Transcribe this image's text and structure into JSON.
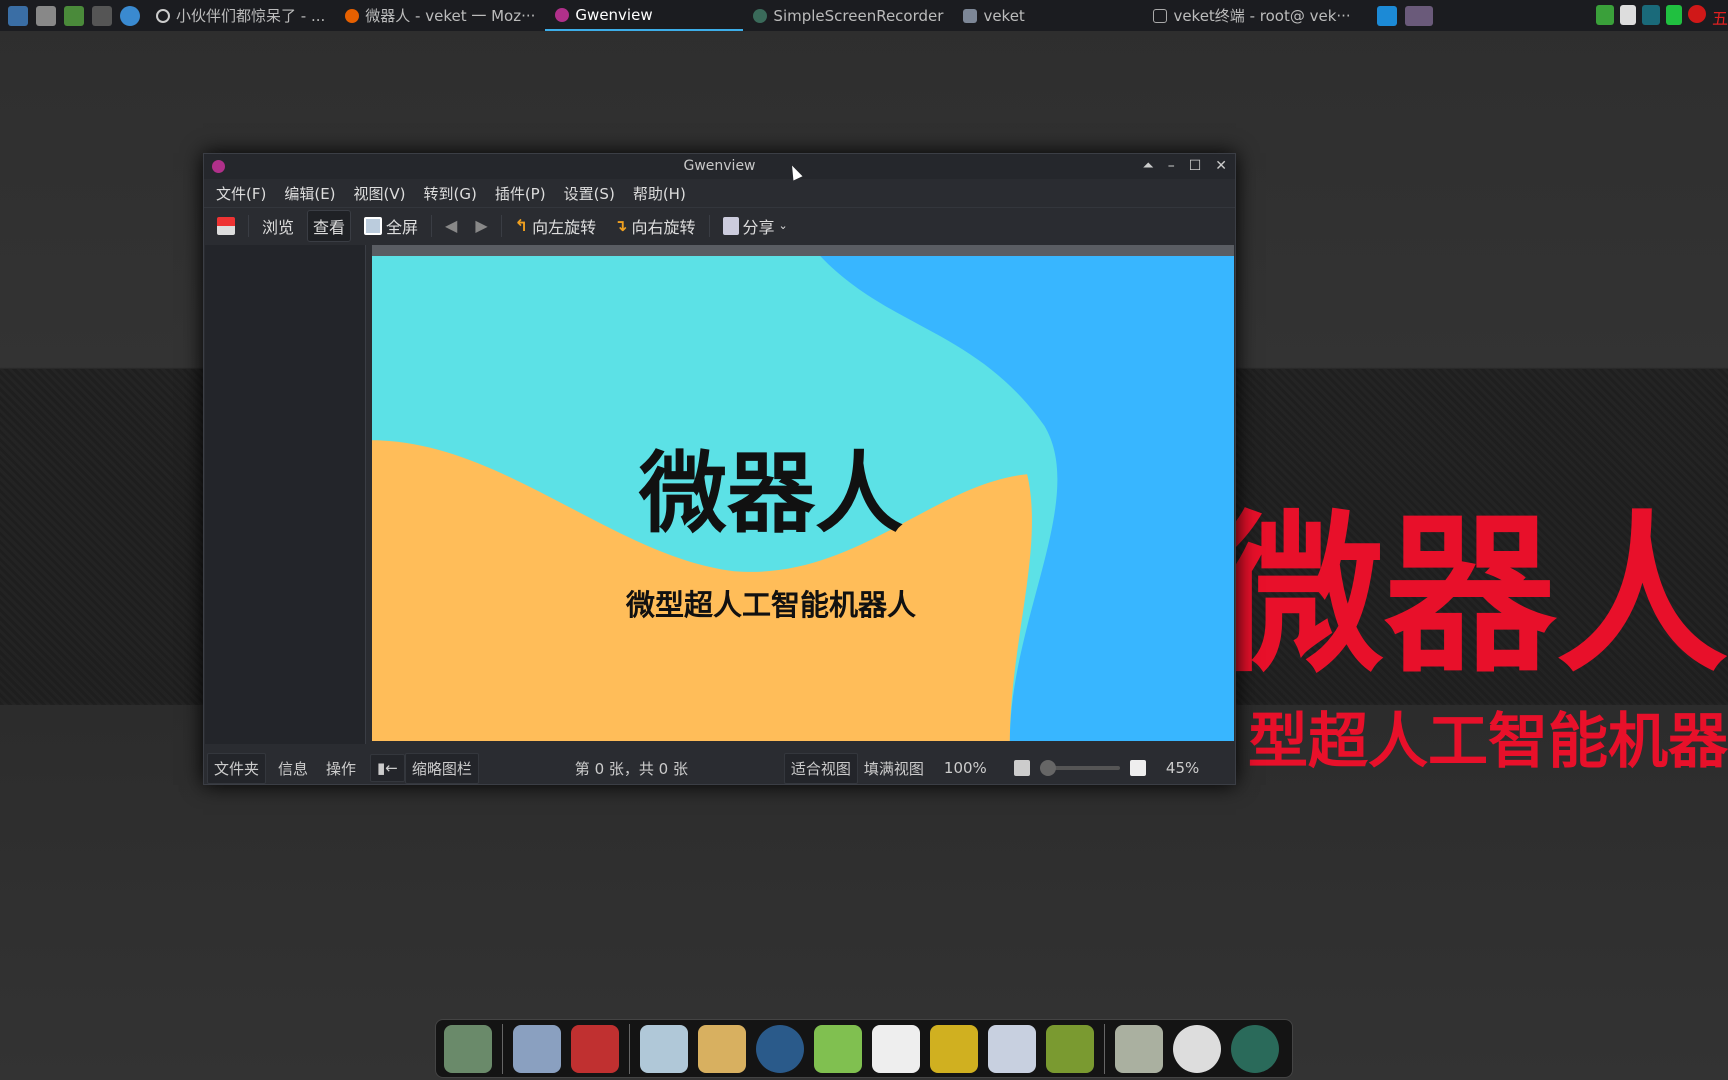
{
  "taskbar": {
    "tasks": [
      {
        "label": "小伙伴们都惊呆了 - ...",
        "icon": "circle-icon"
      },
      {
        "label": "微器人 - veket 一 Moz···",
        "icon": "firefox-icon"
      },
      {
        "label": "Gwenview",
        "icon": "gwenview-icon",
        "active": true
      },
      {
        "label": "SimpleScreenRecorder",
        "icon": "recorder-icon"
      },
      {
        "label": "veket",
        "icon": "folder-icon"
      },
      {
        "label": "veket终端 - root@ vek···",
        "icon": "terminal-icon"
      }
    ],
    "tray_ime": "五"
  },
  "desktop": {
    "title": "微器人",
    "subtitle": "型超人工智能机器"
  },
  "window": {
    "title": "Gwenview",
    "menu": [
      "文件(F)",
      "编辑(E)",
      "视图(V)",
      "转到(G)",
      "插件(P)",
      "设置(S)",
      "帮助(H)"
    ],
    "toolbar": {
      "browse": "浏览",
      "view": "查看",
      "fullscreen": "全屏",
      "rotate_left": "向左旋转",
      "rotate_right": "向右旋转",
      "share": "分享"
    },
    "image": {
      "title": "微器人",
      "subtitle": "微型超人工智能机器人",
      "colors": {
        "cyan": "#5ce1e6",
        "blue": "#38b6ff",
        "orange": "#ffbd59"
      }
    },
    "side_tabs": [
      "文件夹",
      "信息",
      "操作"
    ],
    "status": {
      "thumbbar": "缩略图栏",
      "count": "第 0 张，共 0 张",
      "fit": "适合视图",
      "fill": "填满视图",
      "zoom100": "100%",
      "zoom": "45%",
      "zoom_value": 45
    }
  }
}
